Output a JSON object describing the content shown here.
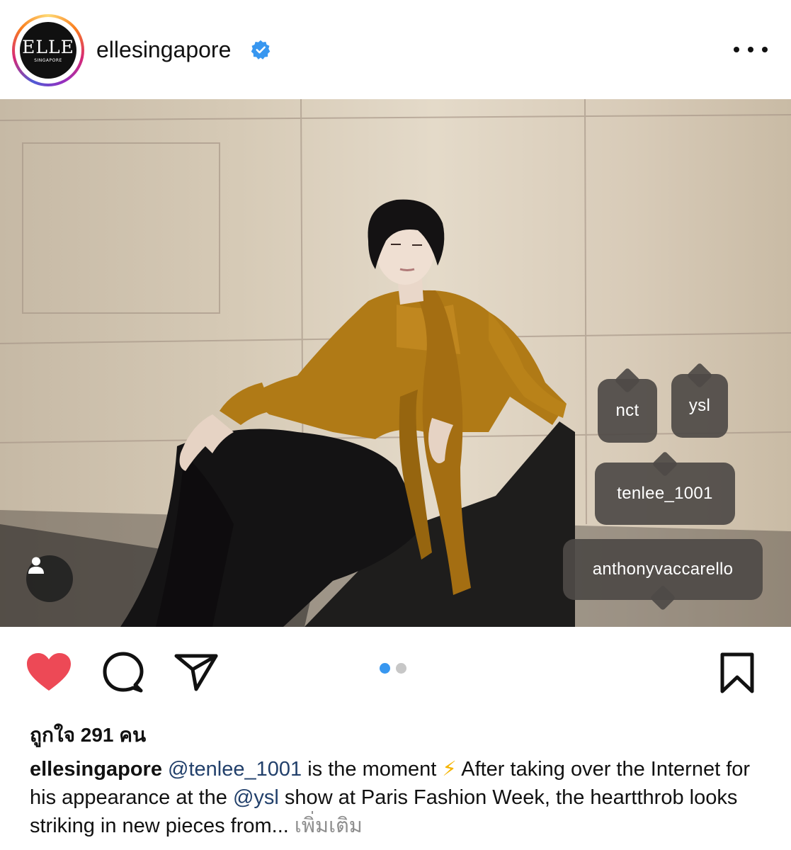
{
  "header": {
    "avatar_logo": "ELLE",
    "avatar_sub": "SINGAPORE",
    "username": "ellesingapore",
    "verified": true,
    "more_icon": "more-horizontal-icon"
  },
  "post": {
    "tags": [
      {
        "label": "nct"
      },
      {
        "label": "ysl"
      },
      {
        "label": "tenlee_1001"
      },
      {
        "label": "anthonyvaccarello"
      }
    ],
    "user_tags_icon": "user-icon",
    "carousel": {
      "current": 1,
      "total": 2
    }
  },
  "actions": {
    "like_icon": "heart-icon",
    "comment_icon": "comment-icon",
    "share_icon": "send-icon",
    "save_icon": "bookmark-icon"
  },
  "likes": {
    "text": "ถูกใจ 291 คน"
  },
  "caption": {
    "username": "ellesingapore",
    "mention1": "@tenlee_1001",
    "text1": " is the moment ",
    "emoji": "⚡",
    "text2": "  After taking over the Internet for his appearance at the ",
    "mention2": "@ysl",
    "text3": " show at Paris Fashion Week, the heartthrob looks striking in new pieces from... ",
    "more": "เพิ่มเติม"
  },
  "colors": {
    "like_red": "#ed4956",
    "verified_blue": "#3897f0",
    "mention_blue": "#22406b",
    "dot_active": "#3897f0",
    "dot_inactive": "#c7c7c7"
  }
}
